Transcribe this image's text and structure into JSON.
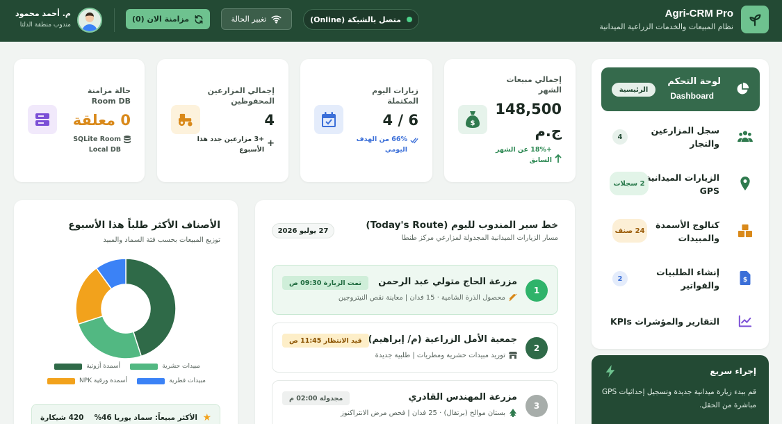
{
  "header": {
    "brand_title": "Agri-CRM Pro",
    "brand_subtitle": "نظام المبيعات والخدمات الزراعية الميدانية",
    "network_status": "متصل بالشبكة (Online)",
    "change_state_label": "تغيير الحالة",
    "sync_label": "مزامنة الان (0)",
    "user_name": "م. أحمد محمود",
    "user_role": "مندوب منطقة الدلتا"
  },
  "sidebar": {
    "active": {
      "label_ar": "لوحة التحكم",
      "label_en": "Dashboard",
      "badge": "الرئيسية"
    },
    "items": [
      {
        "label": "سجل المزارعين والتجار",
        "badge": "4",
        "icon": "users-icon"
      },
      {
        "label": "الزيارات الميدانية GPS",
        "badge": "2 سجلات",
        "icon": "map-pin-icon"
      },
      {
        "label": "كتالوج الأسمدة والمبيدات",
        "badge": "24 صنف",
        "icon": "boxes-icon"
      },
      {
        "label": "إنشاء الطلبيات والفواتير",
        "badge": "2",
        "icon": "invoice-icon"
      },
      {
        "label": "التقارير والمؤشرات KPIs",
        "badge": "",
        "icon": "chart-line-icon"
      }
    ]
  },
  "quick_action": {
    "title": "إجراء سريع",
    "text": "قم ببدء زيارة ميدانية جديدة وتسجيل إحداثيات GPS مباشرة من الحقل."
  },
  "stats": {
    "sales": {
      "title": "إجمالي مبيعات الشهر",
      "value": "148,500",
      "unit": "ج.م",
      "note": "+18% عن الشهر السابق",
      "color": "#2f8a55"
    },
    "visits": {
      "title": "زيارات اليوم المكتملة",
      "value": "6 / 4",
      "note": "66% من الهدف اليومي",
      "color": "#3b6fd8"
    },
    "farmers": {
      "title": "إجمالي المزارعين المحفوظين",
      "value": "4",
      "note": "+3 مزارعين جدد هذا الأسبوع",
      "color": "#2e3b33"
    },
    "sync": {
      "title": "حالة مزامنة Room DB",
      "value": "0 معلقة",
      "note": "SQLite Room Local DB",
      "color": "#d9891a"
    }
  },
  "route": {
    "title": "خط سير المندوب لليوم (Today's Route)",
    "subtitle": "مسار الزيارات الميدانية المجدولة لمزارعي مركز طنطا",
    "date": "27 يوليو 2026",
    "items": [
      {
        "num": "1",
        "name": "مزرعة الحاج متولي عبد الرحمن",
        "desc": "محصول الذرة الشامية · 15 فدان | معاينة نقص النيتروجين",
        "tag": "تمت الزيارة 09:30 ص"
      },
      {
        "num": "2",
        "name": "جمعية الأمل الزراعية (م/ إبراهيم)",
        "desc": "توريد مبيدات حشرية ومطريات | طلبية جديدة",
        "tag": "قيد الانتظار 11:45 ص"
      },
      {
        "num": "3",
        "name": "مزرعة المهندس القادري",
        "desc": "بستان موالح (برتقال) · 25 فدان | فحص مرض الانثراكنوز",
        "tag": "مجدولة 02:00 م"
      }
    ]
  },
  "categories": {
    "title": "الأصناف الأكثر طلباً هذا الأسبوع",
    "subtitle": "توزيع المبيعات بحسب فئة السماد والمبيد",
    "top_label": "الأكثر مبيعاً: سماد يوريا 46%",
    "top_value": "420 شيكارة"
  },
  "chart_data": {
    "type": "pie",
    "series": [
      {
        "name": "أسمدة أزوتية",
        "value": 45,
        "color": "#2f6a48"
      },
      {
        "name": "مبيدات حشرية",
        "value": 25,
        "color": "#52b882"
      },
      {
        "name": "أسمدة ورقية NPK",
        "value": 20,
        "color": "#f2a21c"
      },
      {
        "name": "مبيدات فطرية",
        "value": 10,
        "color": "#3b82f6"
      }
    ]
  }
}
